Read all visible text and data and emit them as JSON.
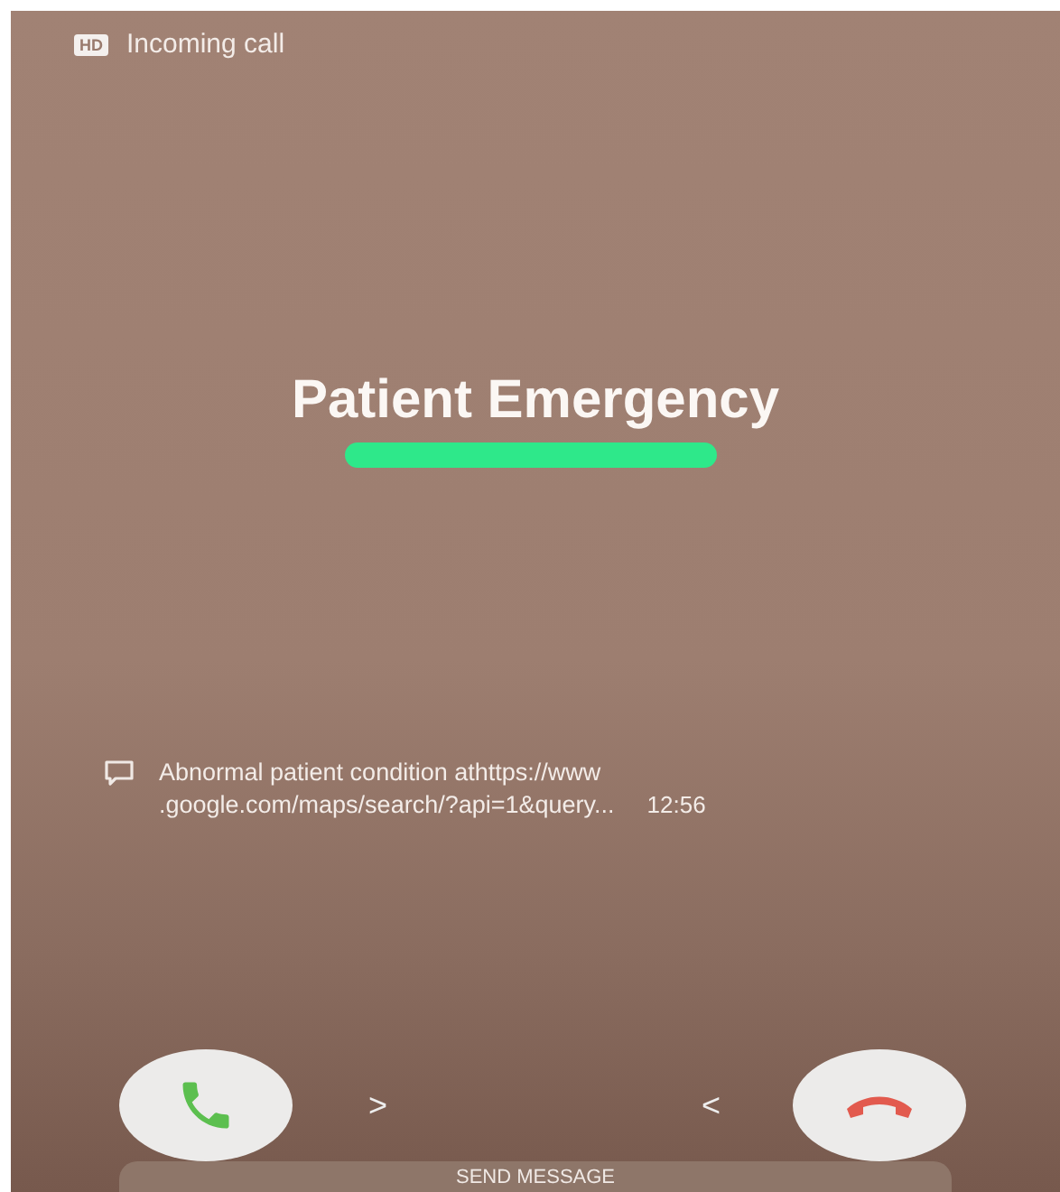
{
  "status": {
    "badge": "HD",
    "title": "Incoming call"
  },
  "caller": {
    "name": "Patient Emergency"
  },
  "message": {
    "lines": [
      "Abnormal patient condition athttps://www",
      ".google.com/maps/search/?api=1&query..."
    ],
    "time": "12:56"
  },
  "actions": {
    "accept_hint": ">",
    "decline_hint": "<"
  },
  "send_message": {
    "label": "SEND MESSAGE"
  }
}
